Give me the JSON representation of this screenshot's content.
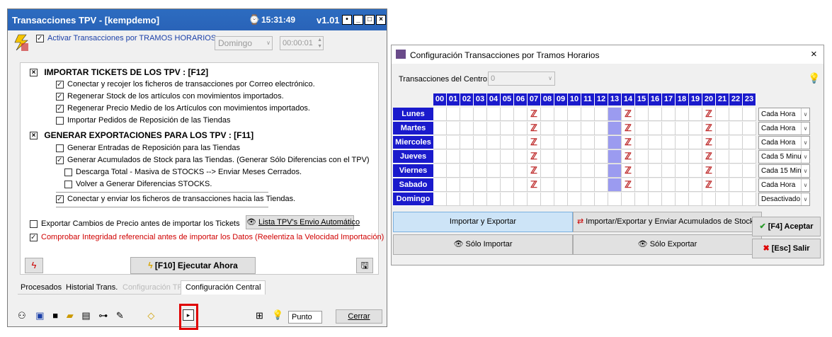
{
  "left_window": {
    "title": "Transacciones TPV - [kempdemo]",
    "time": "15:31:49",
    "version": "v1.01",
    "activate_label": "Activar Transacciones por TRAMOS HORARIOS",
    "day_value": "Domingo",
    "time_value": "00:00:01",
    "import_header": "IMPORTAR TICKETS DE LOS TPV : [F12]",
    "import_items": [
      {
        "label": "Conectar y recojer los ficheros de transacciones por Correo electrónico.",
        "checked": true
      },
      {
        "label": "Regenerar Stock de los artículos con movimientos importados.",
        "checked": true
      },
      {
        "label": "Regenerar Precio Medio de los Artículos con movimientos importados.",
        "checked": true
      },
      {
        "label": "Importar Pedidos de Reposición de las Tiendas",
        "checked": false
      }
    ],
    "export_header": "GENERAR  EXPORTACIONES PARA LOS TPV : [F11]",
    "export_items": [
      {
        "label": "Generar Entradas de Reposición para las Tiendas",
        "checked": false
      },
      {
        "label": "Generar Acumulados de Stock para las Tiendas. (Generar Sólo Diferencias con el TPV)",
        "checked": true
      }
    ],
    "export_subitems": [
      {
        "label": "Descarga Total - Masiva de STOCKS --> Enviar Meses Cerrados.",
        "checked": false
      },
      {
        "label": "Volver a Generar Diferencias STOCKS.",
        "checked": false
      }
    ],
    "connect_send_label": "Conectar y enviar los ficheros de transacciones hacia las Tiendas.",
    "export_price_label": "Exportar Cambios de Precio antes de importar los Tickets",
    "list_button": "Lista TPV's Envio Automático",
    "integrity_label": "Comprobar Integridad referencial antes de importar los Datos  (Reelentiza la Velocidad Importación)",
    "run_button": "[F10] Ejecutar Ahora",
    "tabs": [
      "Procesados",
      "Historial Trans.",
      "Configuración TPV",
      "Configuración Central"
    ],
    "punto_value": "Punto",
    "close_button": "Cerrar"
  },
  "right_window": {
    "title": "Configuración Transacciones por Tramos Horarios",
    "center_label": "Transacciones del Centro:",
    "center_value": "0",
    "hours": [
      "00",
      "01",
      "02",
      "03",
      "04",
      "05",
      "06",
      "07",
      "08",
      "09",
      "10",
      "11",
      "12",
      "13",
      "14",
      "15",
      "16",
      "17",
      "18",
      "19",
      "20",
      "21",
      "22",
      "23"
    ],
    "days": [
      {
        "name": "Lunes",
        "freq": "Cada Hora",
        "marks": [
          7,
          14,
          20
        ]
      },
      {
        "name": "Martes",
        "freq": "Cada Hora",
        "marks": [
          7,
          14,
          20
        ]
      },
      {
        "name": "Miercoles",
        "freq": "Cada Hora",
        "marks": [
          7,
          14,
          20
        ]
      },
      {
        "name": "Jueves",
        "freq": "Cada 5 Minu",
        "marks": [
          7,
          14,
          20
        ]
      },
      {
        "name": "Viernes",
        "freq": "Cada 15 Min",
        "marks": [
          7,
          14,
          20
        ]
      },
      {
        "name": "Sabado",
        "freq": "Cada Hora",
        "marks": [
          7,
          14,
          20
        ]
      },
      {
        "name": "Domingo",
        "freq": "Desactivado",
        "marks": []
      }
    ],
    "highlight_column": 13,
    "btn_import_export": "Importar y Exportar",
    "btn_import_export_stocks": "Importar/Exportar y Enviar Acumulados de Stocks",
    "btn_import_only": "Sólo Importar",
    "btn_export_only": "Sólo Exportar",
    "btn_accept": "[F4] Aceptar",
    "btn_exit": "[Esc] Salir",
    "close_glyph": "×"
  }
}
